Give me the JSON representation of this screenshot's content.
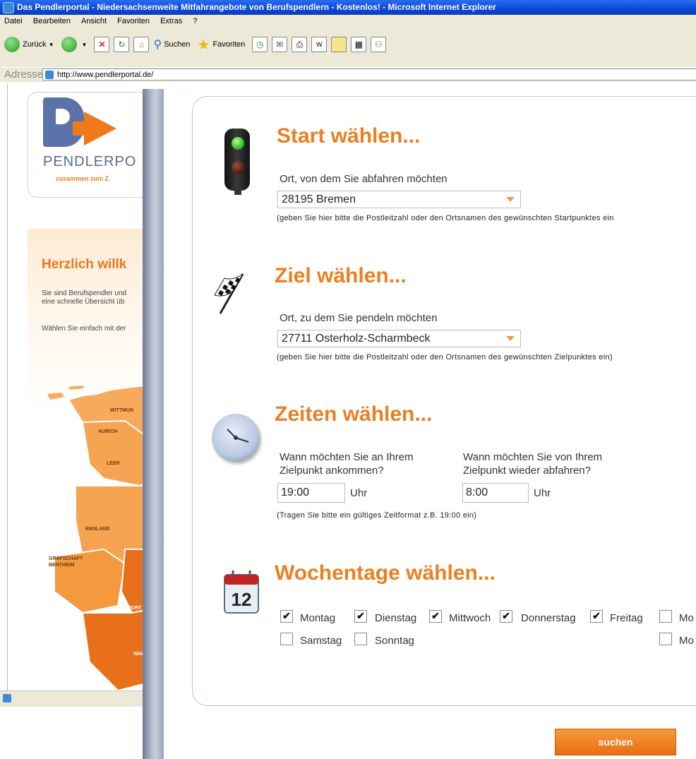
{
  "window": {
    "title": "Das Pendlerportal - Niedersachsenweite Mitfahrangebote von Berufspendlern - Kostenlos! - Microsoft Internet Explorer"
  },
  "menu": [
    "Datei",
    "Bearbeiten",
    "Ansicht",
    "Favoriten",
    "Extras",
    "?"
  ],
  "toolbar": {
    "back_label": "Zurück",
    "search_label": "Suchen",
    "favorites_label": "Favoriten"
  },
  "address": {
    "label": "Adresse",
    "url": "http://www.pendlerportal.de/"
  },
  "background_page": {
    "logo_text": "PENDLERPO",
    "logo_sub": "zusammen zum Z",
    "welcome": "Herzlich willk",
    "text_line1": "Sie sind Berufspendler und",
    "text_line2": "eine schnelle Übersicht üb",
    "text_line3": "Wählen Sie einfach mit der",
    "map_labels": [
      "WITTMUN",
      "AURICH",
      "LEER",
      "EMSLAND",
      "GRAFSCHAFT",
      "BENTHEIM",
      "STEINFURT",
      "WAR"
    ]
  },
  "form": {
    "start": {
      "title": "Start wählen...",
      "label": "Ort, von dem Sie abfahren möchten",
      "value": "28195 Bremen",
      "hint": "(geben Sie hier bitte die Postleitzahl oder den Ortsnamen des gewünschten Startpunktes ein"
    },
    "ziel": {
      "title": "Ziel wählen...",
      "label": "Ort, zu dem Sie pendeln möchten",
      "value": "27711 Osterholz-Scharmbeck",
      "hint": "(geben Sie hier bitte die Postleitzahl oder den Ortsnamen des gewünschten Zielpunktes ein)"
    },
    "zeiten": {
      "title": "Zeiten wählen...",
      "arrive_label_1": "Wann möchten Sie an Ihrem",
      "arrive_label_2": "Zielpunkt ankommen?",
      "arrive_value": "19:00",
      "depart_label_1": "Wann möchten Sie von Ihrem",
      "depart_label_2": "Zielpunkt wieder abfahren?",
      "depart_value": "8:00",
      "unit": "Uhr",
      "hint": "(Tragen Sie bitte ein gültiges Zeitformat z.B. 19:00 ein)"
    },
    "wochentage": {
      "title": "Wochentage wählen...",
      "calendar_number": "12",
      "days": [
        {
          "label": "Montag",
          "checked": true
        },
        {
          "label": "Dienstag",
          "checked": true
        },
        {
          "label": "Mittwoch",
          "checked": true
        },
        {
          "label": "Donnerstag",
          "checked": true
        },
        {
          "label": "Freitag",
          "checked": true
        },
        {
          "label": "Samstag",
          "checked": false
        },
        {
          "label": "Sonntag",
          "checked": false
        },
        {
          "label": "Mo",
          "checked": false
        },
        {
          "label": "Mo",
          "checked": false
        }
      ]
    },
    "submit_label": "suchen"
  },
  "colors": {
    "accent": "#ea7f20",
    "title_bar": "#0a48d8"
  }
}
